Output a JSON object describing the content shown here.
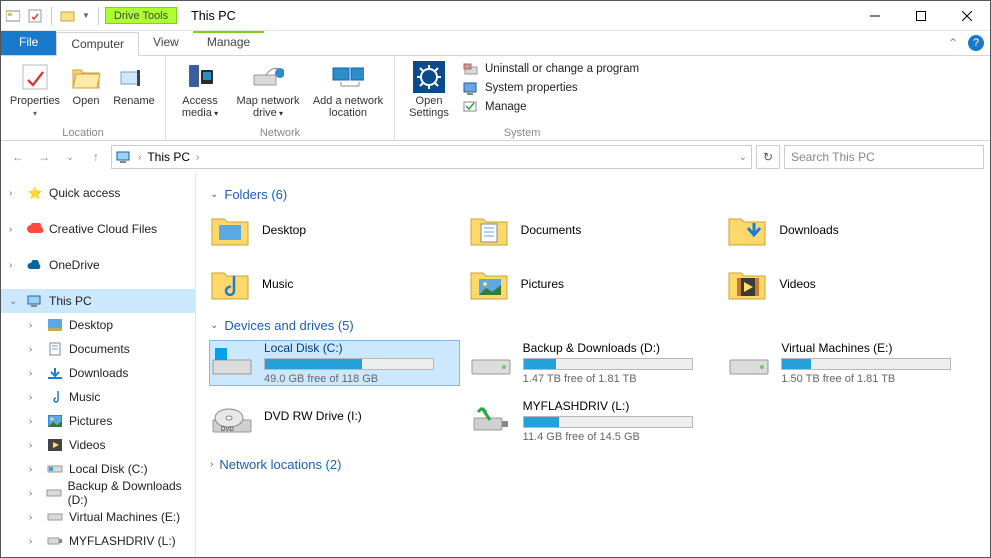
{
  "window": {
    "title": "This PC",
    "tool_tab": "Drive Tools"
  },
  "tabs": {
    "file": "File",
    "computer": "Computer",
    "view": "View",
    "manage": "Manage"
  },
  "ribbon": {
    "location": {
      "properties": "Properties",
      "open": "Open",
      "rename": "Rename",
      "group": "Location"
    },
    "network": {
      "access_media": "Access media",
      "map_drive": "Map network drive",
      "add_loc": "Add a network location",
      "group": "Network"
    },
    "settings": {
      "open_settings": "Open Settings"
    },
    "system": {
      "uninstall": "Uninstall or change a program",
      "sysprops": "System properties",
      "manage": "Manage",
      "group": "System"
    }
  },
  "address": {
    "location": "This PC",
    "search_placeholder": "Search This PC"
  },
  "sidebar": {
    "quick": "Quick access",
    "cc": "Creative Cloud Files",
    "onedrive": "OneDrive",
    "thispc": "This PC",
    "desktop": "Desktop",
    "documents": "Documents",
    "downloads": "Downloads",
    "music": "Music",
    "pictures": "Pictures",
    "videos": "Videos",
    "localc": "Local Disk (C:)",
    "backup": "Backup & Downloads (D:)",
    "vm": "Virtual Machines (E:)",
    "flash": "MYFLASHDRIV (L:)"
  },
  "content": {
    "folders_head": "Folders (6)",
    "folders": {
      "desktop": "Desktop",
      "documents": "Documents",
      "downloads": "Downloads",
      "music": "Music",
      "pictures": "Pictures",
      "videos": "Videos"
    },
    "drives_head": "Devices and drives (5)",
    "drives": {
      "c": {
        "name": "Local Disk (C:)",
        "free": "49.0 GB free of 118 GB",
        "pct": 58
      },
      "d": {
        "name": "Backup & Downloads (D:)",
        "free": "1.47 TB free of 1.81 TB",
        "pct": 19
      },
      "e": {
        "name": "Virtual Machines (E:)",
        "free": "1.50 TB free of 1.81 TB",
        "pct": 17
      },
      "dvd": {
        "name": "DVD RW Drive (I:)"
      },
      "l": {
        "name": "MYFLASHDRIV (L:)",
        "free": "11.4 GB free of 14.5 GB",
        "pct": 21
      }
    },
    "network_head": "Network locations (2)"
  }
}
